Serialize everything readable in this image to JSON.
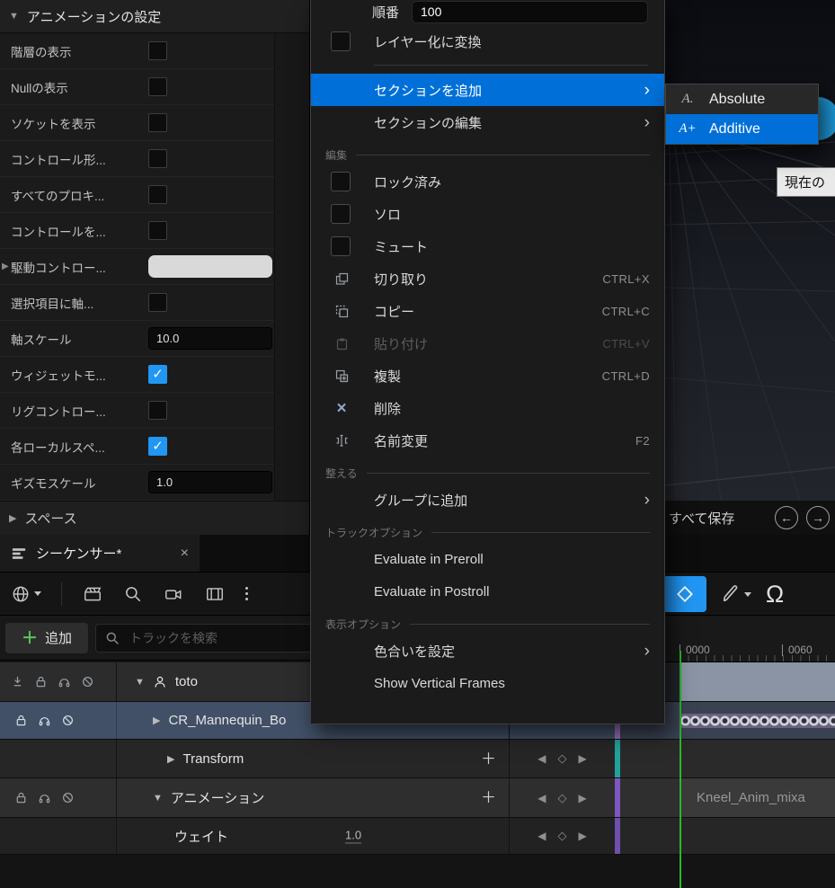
{
  "colors": {
    "accent": "#0070d8",
    "checkbox_checked": "#2196f3",
    "selection_row": "#415066",
    "playhead": "#2db52d"
  },
  "left_panel": {
    "title": "アニメーションの設定",
    "rows": [
      {
        "label": "階層の表示",
        "control": "checkbox",
        "checked": false
      },
      {
        "label": "Nullの表示",
        "control": "checkbox",
        "checked": false
      },
      {
        "label": "ソケットを表示",
        "control": "checkbox",
        "checked": false
      },
      {
        "label": "コントロール形...",
        "control": "checkbox",
        "checked": false
      },
      {
        "label": "すべてのプロキ...",
        "control": "checkbox",
        "checked": false
      },
      {
        "label": "コントロールを...",
        "control": "checkbox",
        "checked": false
      },
      {
        "label": "駆動コントロー...",
        "control": "color-field",
        "value": ""
      },
      {
        "label": "選択項目に軸...",
        "control": "checkbox",
        "checked": false
      },
      {
        "label": "軸スケール",
        "control": "number-field",
        "value": "10.0"
      },
      {
        "label": "ウィジェットモ...",
        "control": "checkbox",
        "checked": true
      },
      {
        "label": "リグコントロー...",
        "control": "checkbox",
        "checked": false
      },
      {
        "label": "各ローカルスペ...",
        "control": "checkbox",
        "checked": true
      },
      {
        "label": "ギズモスケール",
        "control": "number-field",
        "value": "1.0"
      }
    ],
    "footer": "スペース"
  },
  "menu": {
    "order_label": "順番",
    "order_value": "100",
    "convert_layer": "レイヤー化に変換",
    "add_section": "セクションを追加",
    "edit_section": "セクションの編集",
    "header_edit": "編集",
    "locked": "ロック済み",
    "solo": "ソロ",
    "mute": "ミュート",
    "cut": "切り取り",
    "cut_key": "CTRL+X",
    "copy": "コピー",
    "copy_key": "CTRL+C",
    "paste": "貼り付け",
    "paste_key": "CTRL+V",
    "duplicate": "複製",
    "duplicate_key": "CTRL+D",
    "delete": "削除",
    "rename": "名前変更",
    "rename_key": "F2",
    "header_arrange": "整える",
    "add_to_group": "グループに追加",
    "header_track_options": "トラックオプション",
    "eval_preroll": "Evaluate in Preroll",
    "eval_postroll": "Evaluate in Postroll",
    "header_display_options": "表示オプション",
    "set_tint": "色合いを設定",
    "show_vertical_frames": "Show Vertical Frames"
  },
  "submenu": {
    "absolute": {
      "label": "Absolute",
      "glyph": "A."
    },
    "additive": {
      "label": "Additive",
      "glyph": "A+"
    }
  },
  "viewport": {
    "tooltip": "現在の"
  },
  "save_bar": {
    "save_all": "すべて保存",
    "back": "←",
    "forward": "→"
  },
  "sequencer": {
    "tab_title": "シーケンサー*",
    "close": "×",
    "add_label": "追加",
    "search_placeholder": "トラックを検索",
    "ruler_marks": [
      "0000",
      "0060"
    ],
    "tracks": [
      {
        "name": "toto"
      },
      {
        "name": "CR_Mannequin_Bo",
        "selected": true
      },
      {
        "name": "Transform"
      },
      {
        "name": "アニメーション"
      },
      {
        "name": "ウェイト",
        "weight": "1.0"
      }
    ],
    "clip_label": "Kneel_Anim_mixa"
  }
}
